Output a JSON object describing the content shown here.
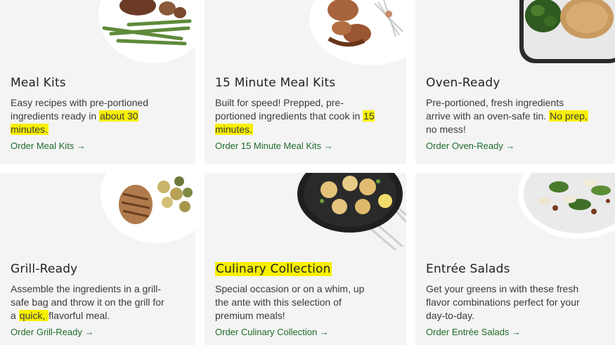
{
  "cards": [
    {
      "title": "Meal Kits",
      "desc_a": "Easy recipes with pre-portioned ingredients ready in ",
      "desc_hl": "about 30 minutes.",
      "desc_b": "",
      "link": "Order Meal Kits →"
    },
    {
      "title": "15 Minute Meal Kits",
      "desc_a": "Built for speed! Prepped, pre-portioned ingredients that cook in ",
      "desc_hl": "15 minutes.",
      "desc_b": "",
      "link": "Order 15 Minute Meal Kits →"
    },
    {
      "title": "Oven-Ready",
      "desc_a": "Pre-portioned, fresh ingredients arrive with an oven-safe tin. ",
      "desc_hl": "No prep, ",
      "desc_b": "no mess!",
      "link": "Order Oven-Ready →"
    },
    {
      "title": "Grill-Ready",
      "desc_a": "Assemble the ingredients in a grill-safe bag and throw it on the grill for a ",
      "desc_hl": "quick, ",
      "desc_b": "flavorful meal.",
      "link": "Order Grill-Ready →"
    },
    {
      "title": "Culinary Collection",
      "desc_a": "Special occasion or on a whim, up the ante with this selection of premium meals!",
      "desc_hl": "",
      "desc_b": "",
      "link": "Order Culinary Collection →"
    },
    {
      "title": "Entrée Salads",
      "desc_a": "Get your greens in with these fresh flavor combinations perfect for your day-to-day.",
      "desc_hl": "",
      "desc_b": "",
      "link": "Order Entrée Salads →"
    }
  ],
  "colors": {
    "card_bg": "#f4f4f4",
    "link": "#1f6b2a",
    "highlight": "#f8f000"
  }
}
